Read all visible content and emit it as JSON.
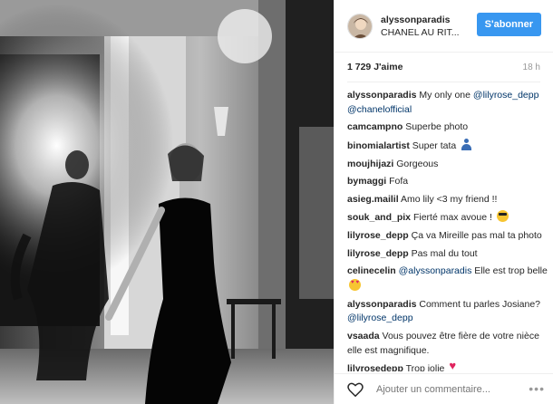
{
  "post": {
    "username": "alyssonparadis",
    "location": "CHANEL AU RIT...",
    "follow_label": "S'abonner",
    "likes": "1 729 J'aime",
    "time_ago": "18 h"
  },
  "comments": [
    {
      "user": "alyssonparadis",
      "parts": [
        {
          "t": "My only one "
        },
        {
          "m": "@lilyrose_depp"
        },
        {
          "t": " "
        },
        {
          "m": "@chanelofficial"
        }
      ]
    },
    {
      "user": "camcampno",
      "parts": [
        {
          "t": "Superbe photo"
        }
      ]
    },
    {
      "user": "binomialartist",
      "parts": [
        {
          "t": "Super tata "
        }
      ],
      "emoji": "person"
    },
    {
      "user": "moujhijazi",
      "parts": [
        {
          "t": "Gorgeous"
        }
      ]
    },
    {
      "user": "bymaggi",
      "parts": [
        {
          "t": "Fofa"
        }
      ]
    },
    {
      "user": "asieg.mailil",
      "parts": [
        {
          "t": "Amo lily <3 my friend !!"
        }
      ]
    },
    {
      "user": "souk_and_pix",
      "parts": [
        {
          "t": "Fierté max avoue ! "
        }
      ],
      "emoji": "cool"
    },
    {
      "user": "lilyrose_depp",
      "parts": [
        {
          "t": "Ça va Mireille pas mal ta photo"
        }
      ]
    },
    {
      "user": "lilyrose_depp",
      "parts": [
        {
          "t": "Pas mal du tout"
        }
      ]
    },
    {
      "user": "celinecelin",
      "parts": [
        {
          "m": "@alyssonparadis"
        },
        {
          "t": " Elle est trop belle "
        }
      ],
      "emoji": "love"
    },
    {
      "user": "alyssonparadis",
      "parts": [
        {
          "t": "Comment tu parles Josiane? "
        },
        {
          "m": "@lilyrose_depp"
        }
      ]
    },
    {
      "user": "vsaada",
      "parts": [
        {
          "t": "Vous pouvez être fière de votre nièce elle est magnifique."
        }
      ]
    },
    {
      "user": "lilyrosedepp",
      "parts": [
        {
          "t": "Trop jolie "
        }
      ],
      "emoji": "heart"
    }
  ],
  "footer": {
    "comment_placeholder": "Ajouter un commentaire...",
    "more_label": "•••"
  },
  "colors": {
    "accent": "#3897f0",
    "mention": "#003569"
  }
}
